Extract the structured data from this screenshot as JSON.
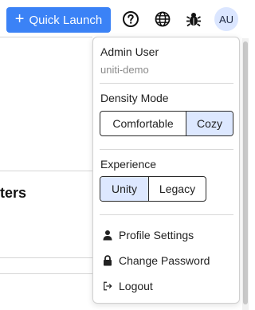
{
  "topbar": {
    "quick_launch_label": "Quick Launch",
    "avatar_initials": "AU"
  },
  "background": {
    "heading_fragment": "ters"
  },
  "menu": {
    "user_name": "Admin User",
    "tenant": "uniti-demo",
    "density": {
      "label": "Density Mode",
      "options": [
        "Comfortable",
        "Cozy"
      ],
      "selected": "Cozy"
    },
    "experience": {
      "label": "Experience",
      "options": [
        "Unity",
        "Legacy"
      ],
      "selected": "Unity"
    },
    "items": [
      {
        "label": "Profile Settings",
        "icon": "user-icon"
      },
      {
        "label": "Change Password",
        "icon": "lock-icon"
      },
      {
        "label": "Logout",
        "icon": "logout-icon"
      }
    ]
  },
  "colors": {
    "primary": "#3b82f6",
    "selected_segment": "#dde8ff",
    "avatar_bg": "#dbe6ff"
  }
}
